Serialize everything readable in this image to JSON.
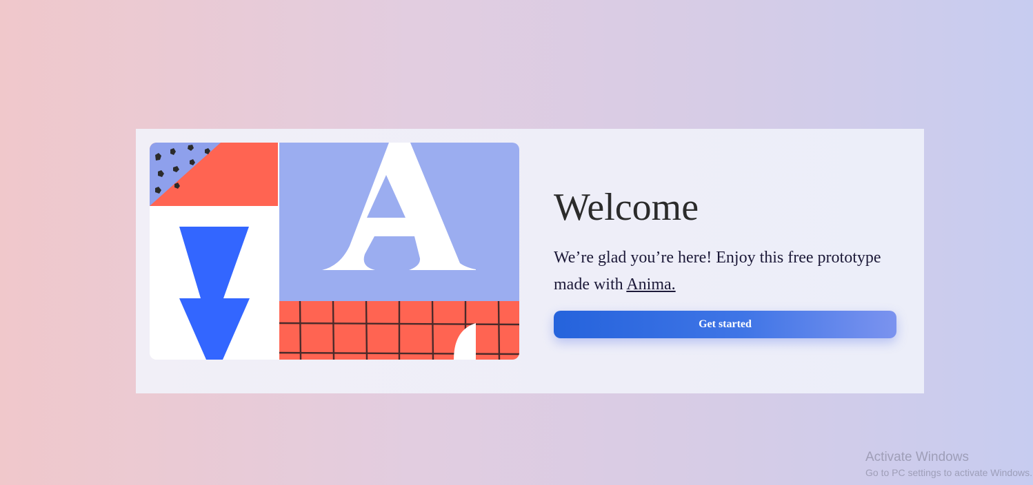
{
  "welcome": {
    "title": "Welcome",
    "intro_text": "We’re glad you’re here! Enjoy this free prototype made with ",
    "link_text": "Anima.",
    "cta_label": "Get started"
  },
  "illustration": {
    "letter": "A",
    "colors": {
      "periwinkle": "#9badf0",
      "coral": "#ff6452",
      "blue": "#3366ff",
      "white": "#ffffff",
      "dark": "#2b2b2b"
    }
  },
  "os_watermark": {
    "title": "Activate Windows",
    "subtitle": "Go to PC settings to activate Windows."
  }
}
